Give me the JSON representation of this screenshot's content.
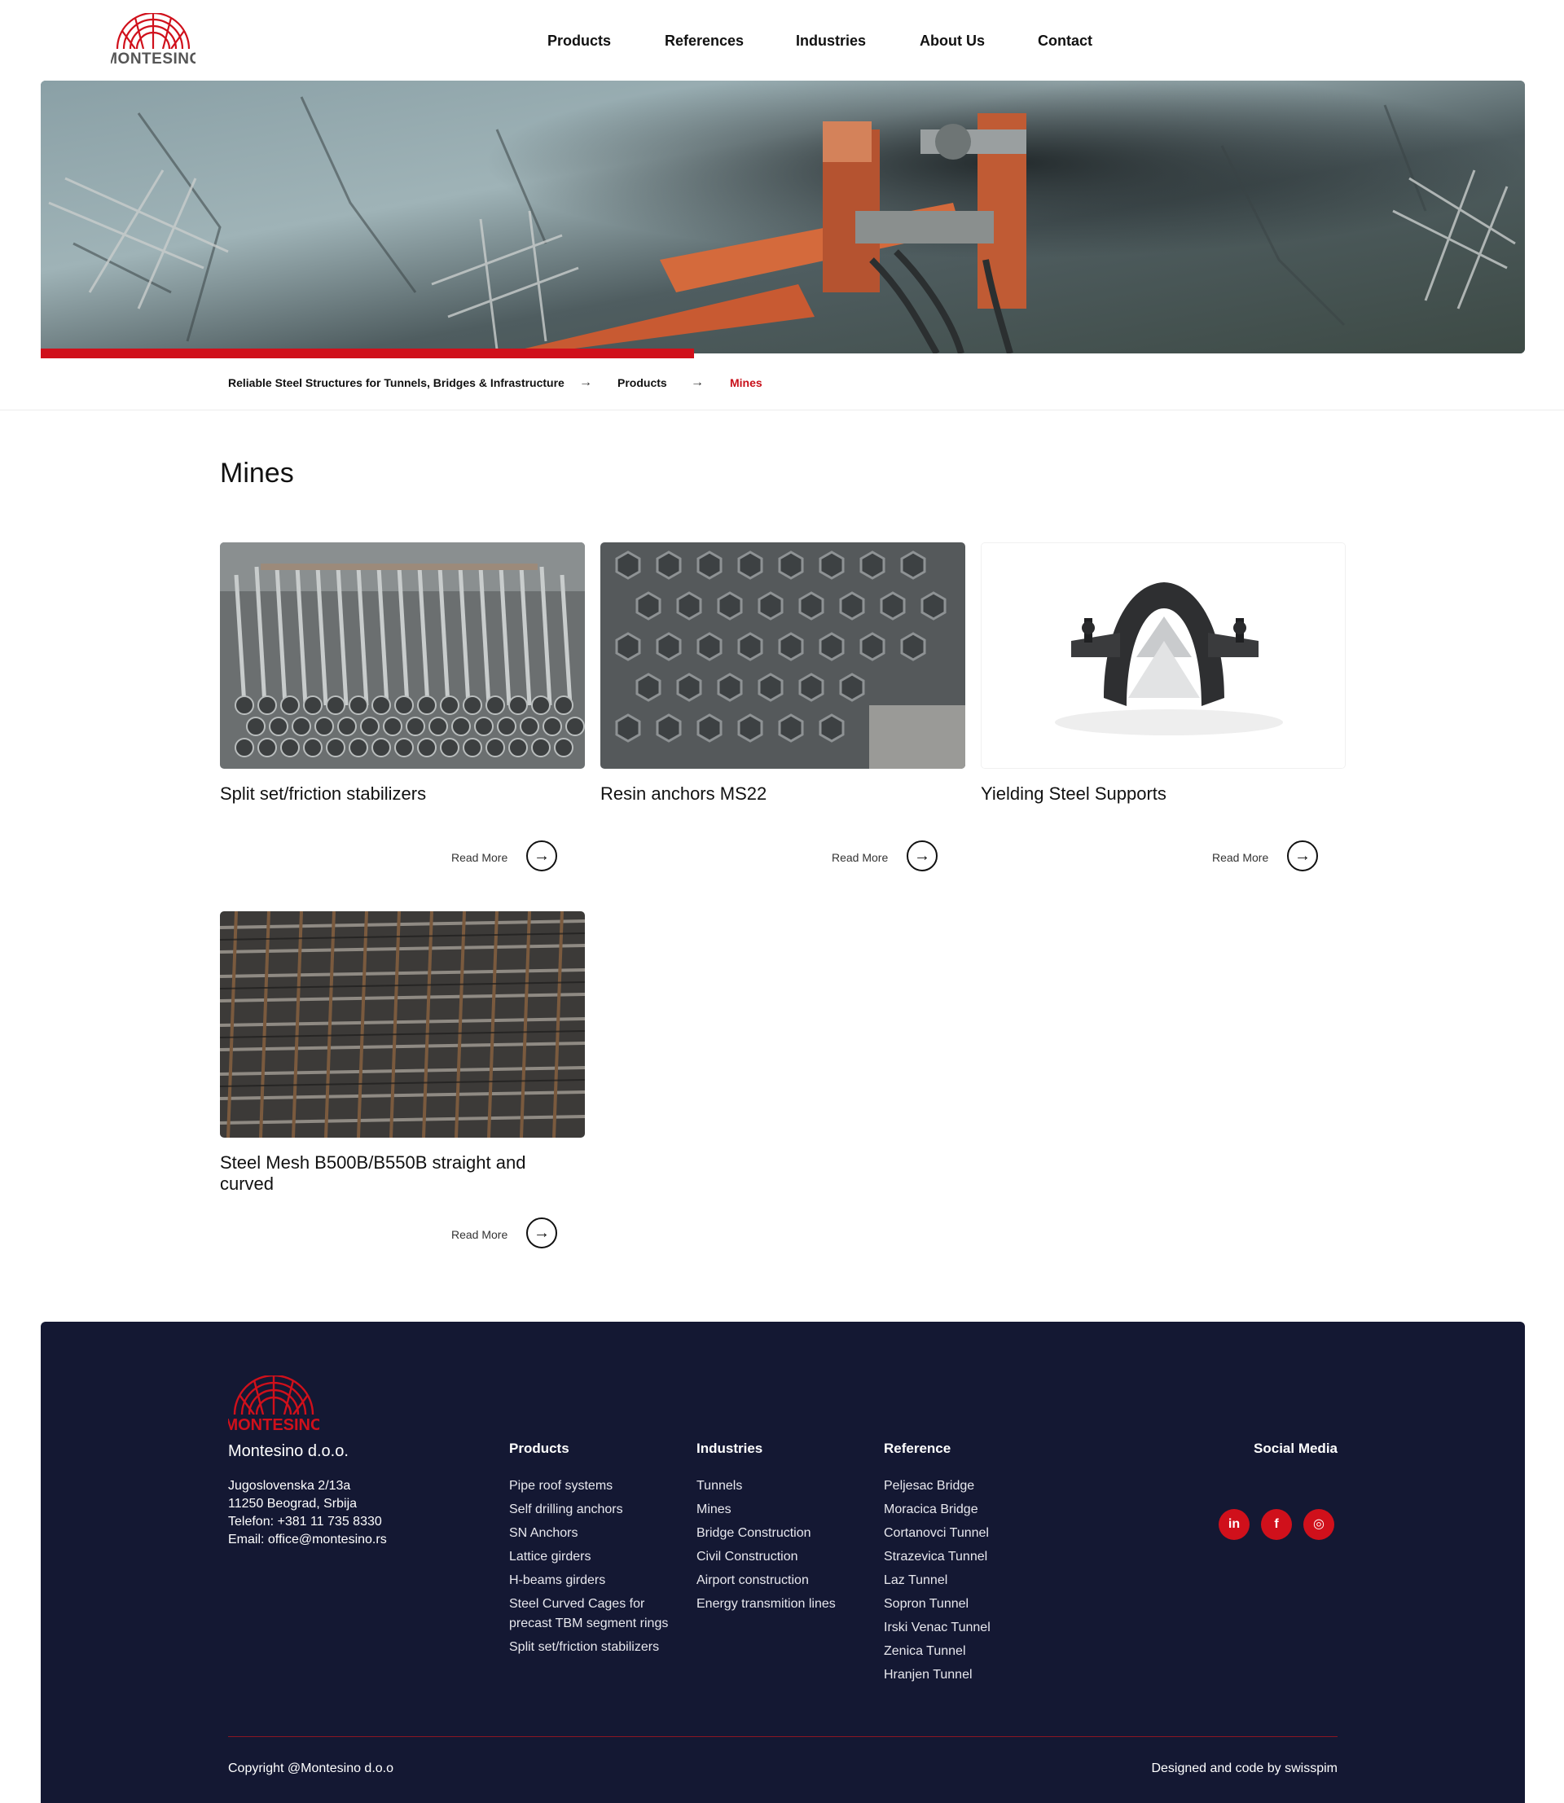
{
  "brand": {
    "name": "MONTESINO",
    "color": "#d0101b",
    "text_color": "#555555"
  },
  "nav": {
    "items": [
      {
        "label": "Products"
      },
      {
        "label": "References"
      },
      {
        "label": "Industries"
      },
      {
        "label": "About Us"
      },
      {
        "label": "Contact"
      }
    ]
  },
  "hero": {
    "progress_fraction": 0.44
  },
  "breadcrumb": {
    "items": [
      {
        "label": "Reliable Steel Structures for Tunnels, Bridges & Infrastructure"
      },
      {
        "label": "Products"
      },
      {
        "label": "Mines"
      }
    ],
    "separator_icon": "arrow-right-icon"
  },
  "page": {
    "title": "Mines"
  },
  "cards": [
    {
      "title": "Split set/friction stabilizers",
      "read_more": "Read More",
      "icon": "arrow-right-icon"
    },
    {
      "title": "Resin anchors MS22",
      "read_more": "Read More",
      "icon": "arrow-right-icon"
    },
    {
      "title": "Yielding Steel Supports",
      "read_more": "Read More",
      "icon": "arrow-right-icon"
    },
    {
      "title": "Steel Mesh B500B/B550B straight and curved",
      "read_more": "Read More",
      "icon": "arrow-right-icon"
    }
  ],
  "footer": {
    "company": "Montesino d.o.o.",
    "address": [
      "Jugoslovenska 2/13a",
      "11250 Beograd, Srbija",
      "Telefon: +381 11 735 8330",
      "Email: office@montesino.rs"
    ],
    "columns": [
      {
        "title": "Products",
        "links": [
          "Pipe roof systems",
          "Self drilling anchors",
          "SN Anchors",
          "Lattice girders",
          "H-beams girders",
          "Steel Curved Cages for",
          "precast TBM segment rings",
          "Split set/friction stabilizers"
        ]
      },
      {
        "title": "Industries",
        "links": [
          "Tunnels",
          "Mines",
          "Bridge Construction",
          "Civil Construction",
          "Airport construction",
          "Energy transmition lines"
        ]
      },
      {
        "title": "Reference",
        "links": [
          "Peljesac Bridge",
          "Moracica Bridge",
          "Cortanovci Tunnel",
          "Strazevica Tunnel",
          "Laz Tunnel",
          "Sopron Tunnel",
          "Irski Venac Tunnel",
          "Zenica Tunnel",
          "Hranjen Tunnel"
        ]
      }
    ],
    "social": {
      "title": "Social Media",
      "items": [
        {
          "label": "in",
          "icon": "linkedin-icon"
        },
        {
          "label": "f",
          "icon": "facebook-icon"
        },
        {
          "label": "◎",
          "icon": "instagram-icon"
        }
      ]
    },
    "copyright": "Copyright @Montesino d.o.o",
    "credit": "Designed and code by swisspim",
    "background": "#141833"
  }
}
